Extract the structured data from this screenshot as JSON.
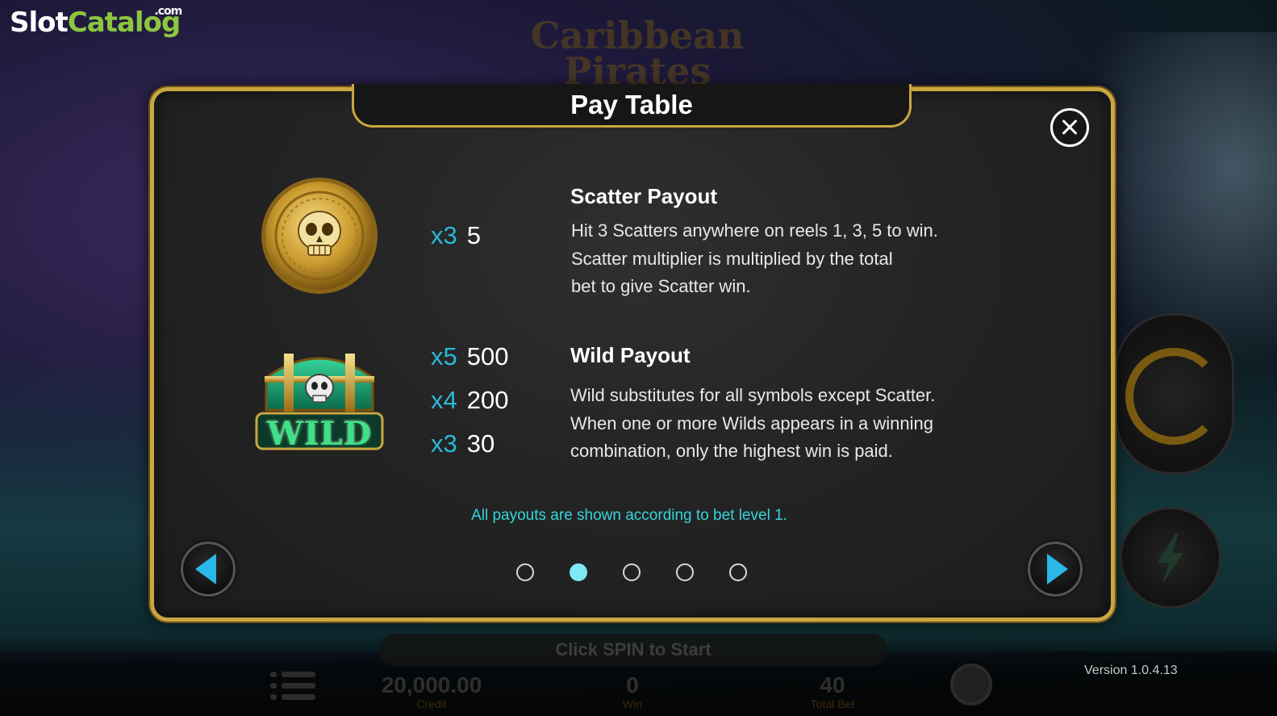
{
  "watermark": {
    "slot": "Slot",
    "catalog": "Catalog",
    "com": ".com"
  },
  "background": {
    "game_title_line1": "Caribbean",
    "game_title_line2": "Pirates"
  },
  "hud": {
    "start_prompt": "Click SPIN to Start",
    "credit_value": "20,000.00",
    "credit_label": "Credit",
    "win_value": "0",
    "win_label": "Win",
    "total_bet_value": "40",
    "total_bet_label": "Total Bet",
    "version": "Version 1.0.4.13"
  },
  "paytable": {
    "title": "Pay Table",
    "scatter": {
      "icon": "skull-coin-icon",
      "payouts": [
        {
          "mult": "x3",
          "pay": "5"
        }
      ],
      "heading": "Scatter Payout",
      "lines": [
        "Hit 3 Scatters anywhere on reels 1, 3, 5 to win.",
        "Scatter multiplier is multiplied by the total",
        "bet to give Scatter win."
      ]
    },
    "wild": {
      "icon": "wild-chest-icon",
      "symbol_text": "WILD",
      "payouts": [
        {
          "mult": "x5",
          "pay": "500"
        },
        {
          "mult": "x4",
          "pay": "200"
        },
        {
          "mult": "x3",
          "pay": "30"
        }
      ],
      "heading": "Wild Payout",
      "lines": [
        "Wild substitutes for all symbols except Scatter.",
        "When one or more Wilds appears in a winning",
        "combination, only the highest win is paid."
      ]
    },
    "note": "All payouts are shown according to bet level 1.",
    "pagination": {
      "total_pages": 5,
      "current_page": 2
    },
    "colors": {
      "gold": "#c9a640",
      "accent": "#29b8d8",
      "note": "#35d4dc"
    }
  }
}
